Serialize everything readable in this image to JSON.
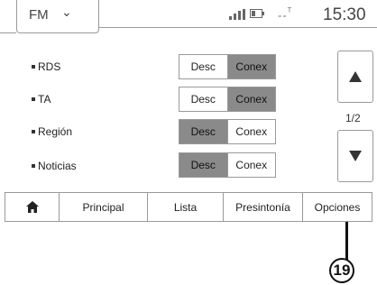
{
  "header": {
    "source": "FM",
    "source_chevron_icon": "chevron-down-icon",
    "status_signal_icon": "signal-bars-icon",
    "status_battery_icon": "battery-icon",
    "status_network": "--",
    "clock": "15:30"
  },
  "settings": [
    {
      "label": "RDS",
      "off": "Desc",
      "on": "Conex",
      "selected": "on"
    },
    {
      "label": "TA",
      "off": "Desc",
      "on": "Conex",
      "selected": "on"
    },
    {
      "label": "Región",
      "off": "Desc",
      "on": "Conex",
      "selected": "off"
    },
    {
      "label": "Noticias",
      "off": "Desc",
      "on": "Conex",
      "selected": "off"
    }
  ],
  "pager": {
    "up_icon": "triangle-up-icon",
    "down_icon": "triangle-down-icon",
    "indicator": "1/2"
  },
  "tabs": {
    "home_icon": "home-icon",
    "principal": "Principal",
    "lista": "Lista",
    "presintonia": "Presintonía",
    "opciones": "Opciones"
  },
  "callout": {
    "number": "19"
  },
  "colors": {
    "active_segment": "#8a8a8a",
    "border": "#9a9a9a"
  }
}
